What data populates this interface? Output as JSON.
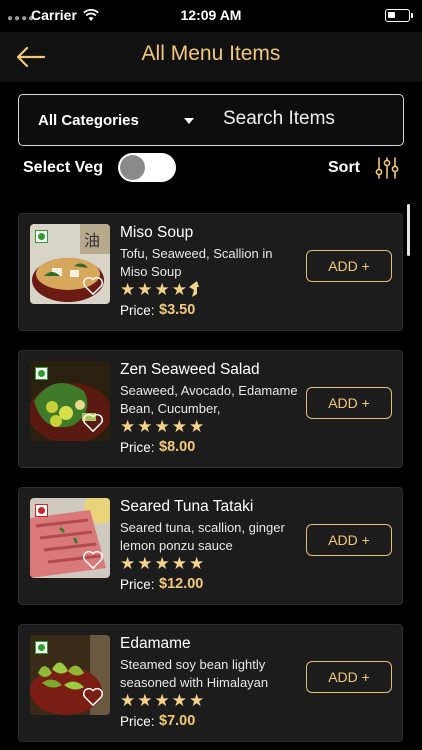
{
  "status_bar": {
    "carrier": "Carrier",
    "time": "12:09 AM"
  },
  "header": {
    "title": "All Menu Items"
  },
  "filters": {
    "category": "All Categories",
    "search_placeholder": "Search Items",
    "veg_label": "Select Veg",
    "sort_label": "Sort"
  },
  "items": [
    {
      "name": "Miso Soup",
      "desc": "Tofu, Seaweed, Scallion in Miso Soup",
      "stars": "★★★★",
      "half_star": true,
      "price_label": "Price:",
      "price": "$3.50",
      "add": "ADD +",
      "veg": true
    },
    {
      "name": "Zen Seaweed Salad",
      "desc": "Seaweed, Avocado, Edamame Bean, Cucumber,",
      "stars": "★★★★★",
      "half_star": false,
      "price_label": "Price:",
      "price": "$8.00",
      "add": "ADD +",
      "veg": true
    },
    {
      "name": "Seared Tuna Tataki",
      "desc": "Seared tuna, scallion, ginger lemon ponzu sauce",
      "stars": "★★★★★",
      "half_star": false,
      "price_label": "Price:",
      "price": "$12.00",
      "add": "ADD +",
      "veg": false
    },
    {
      "name": "Edamame",
      "desc": "Steamed soy bean lightly seasoned with Himalayan",
      "stars": "★★★★★",
      "half_star": false,
      "price_label": "Price:",
      "price": "$7.00",
      "add": "ADD +",
      "veg": true
    }
  ],
  "colors": {
    "accent": "#f2c97a",
    "card": "#1c1c1c",
    "background": "#000000",
    "veg": "#2e9e2e",
    "nonveg": "#c62828"
  }
}
